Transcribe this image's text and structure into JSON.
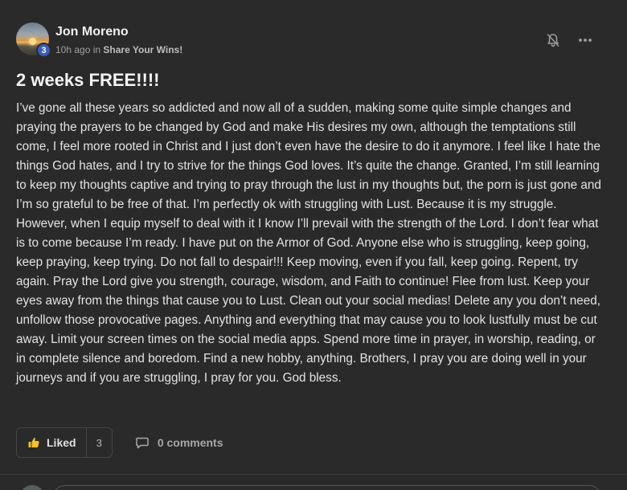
{
  "post": {
    "author": "Jon Moreno",
    "level": "3",
    "time_ago": "10h ago",
    "in_word": "in",
    "group": "Share Your Wins!",
    "title": "2 weeks FREE!!!!",
    "body": "I’ve gone all these years so addicted and now all of a sudden, making some quite simple changes and praying the prayers to be changed by God and make His desires my own, although the temptations still come, I feel more rooted in Christ and I just don’t even have the desire to do it anymore. I feel like I hate the things God hates, and I try to strive for the things God loves. It’s quite the change. Granted, I’m still learning to keep my thoughts captive and trying to pray through the lust in my thoughts but, the porn is just gone and I’m so grateful to be free of that. I’m perfectly ok with struggling with Lust. Because it is my struggle. However, when I equip myself to deal with it I know I’ll prevail with the strength of the Lord. I don’t fear what is to come because I’m ready. I have put on the Armor of God. Anyone else who is struggling, keep going, keep praying, keep trying. Do not fall to despair!!! Keep moving, even if you fall, keep going. Repent, try again. Pray the Lord give you strength, courage, wisdom, and Faith to continue! Flee from lust. Keep your eyes away from the things that cause you to Lust. Clean out your social medias! Delete any you don’t need, unfollow those provocative pages. Anything and everything that may cause you to look lustfully must be cut away. Limit your screen times on the social media apps. Spend more time in prayer, in worship, reading, or in complete silence and boredom. Find a new hobby, anything. Brothers, I pray you are doing well in your journeys and if you are struggling, I pray for you. God bless."
  },
  "actions": {
    "like_label": "Liked",
    "like_count": "3",
    "comments_label": "0 comments"
  },
  "icons": {
    "bell": "bell-off-icon",
    "more": "more-horizontal-icon",
    "like": "thumbs-up-icon",
    "comment": "comment-icon"
  },
  "colors": {
    "background": "#2a2a2b",
    "level_badge": "#3b5bbd",
    "like_icon": "#f0c030"
  }
}
